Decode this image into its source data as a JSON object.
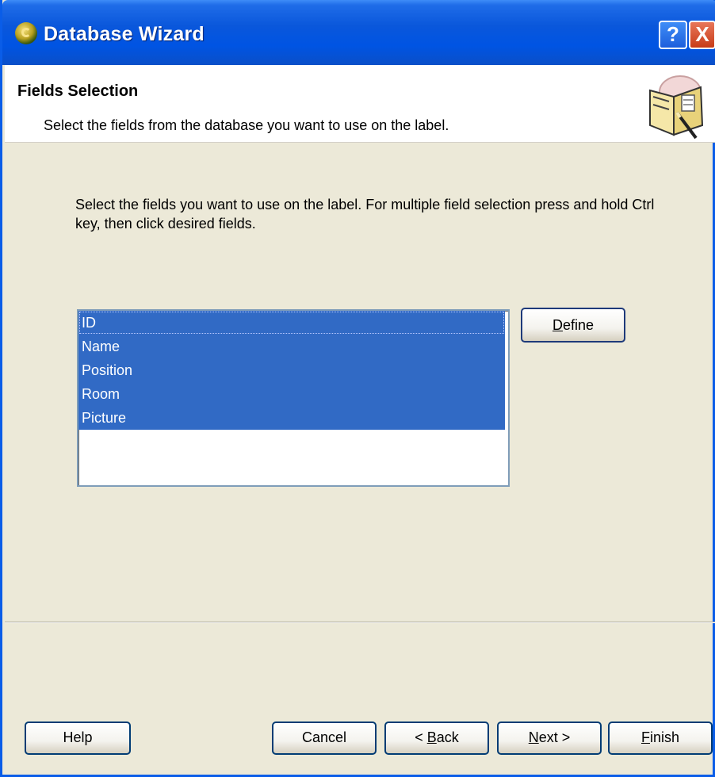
{
  "window": {
    "title": "Database Wizard",
    "help_glyph": "?",
    "close_glyph": "X"
  },
  "header": {
    "title": "Fields Selection",
    "subtitle": "Select the fields from the database you want to use on the label.",
    "icon": "wizard-book-icon"
  },
  "body": {
    "instructions": "Select the fields you want to use on the label. For multiple field selection press and hold Ctrl key, then click desired fields."
  },
  "fields_list": {
    "items": [
      "ID",
      "Name",
      "Position",
      "Room",
      "Picture"
    ],
    "selection_color": "#316AC5"
  },
  "define_button": {
    "label_accel": "D",
    "label_rest": "efine"
  },
  "footer": {
    "help": "Help",
    "cancel": "Cancel",
    "back_prefix": "< ",
    "back_accel": "B",
    "back_rest": "ack",
    "next_accel": "N",
    "next_rest": "ext >",
    "finish_accel": "F",
    "finish_rest": "inish"
  },
  "colors": {
    "titlebar": "#0054E3",
    "dialog_bg": "#ECE9D8",
    "header_bg": "#FFFFFF"
  }
}
